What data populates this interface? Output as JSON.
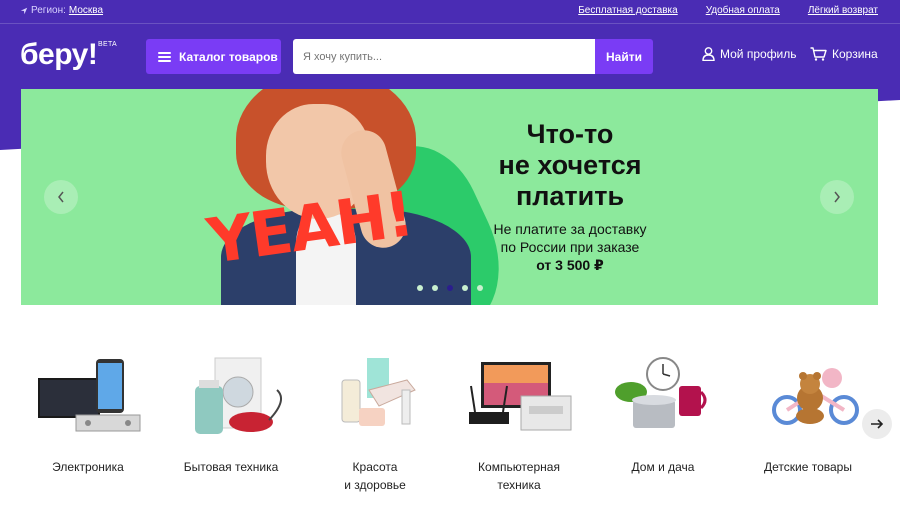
{
  "topbar": {
    "region_label": "Регион:",
    "region_city": "Москва",
    "links": [
      "Бесплатная доставка",
      "Удобная оплата",
      "Лёгкий возврат"
    ]
  },
  "header": {
    "logo": "беру!",
    "logo_badge": "BETA",
    "catalog_label": "Каталог товаров",
    "search_placeholder": "Я хочу купить...",
    "search_button": "Найти",
    "profile_label": "Мой профиль",
    "cart_label": "Корзина"
  },
  "banner": {
    "overlay_text": "YEAH!",
    "title_lines": [
      "Что-то",
      "не хочется",
      "платить"
    ],
    "subtitle_lines": [
      "Не платите за доставку",
      "по России при заказе"
    ],
    "subtitle_amount": "от 3 500 ₽",
    "active_slide": 3,
    "slide_count": 5
  },
  "categories": [
    {
      "label": "Электроника",
      "icon": "electronics-icon"
    },
    {
      "label": "Бытовая техника",
      "icon": "appliances-icon"
    },
    {
      "label": "Красота\nи здоровье",
      "icon": "beauty-icon"
    },
    {
      "label": "Компьютерная\nтехника",
      "icon": "computer-icon"
    },
    {
      "label": "Дом и дача",
      "icon": "home-icon"
    },
    {
      "label": "Детские товары",
      "icon": "kids-icon"
    }
  ],
  "colors": {
    "header_purple": "#4a2cb4",
    "accent_purple": "#7a3cf5",
    "banner_green": "#8ce99c",
    "yeah_red": "#ff3a2a"
  }
}
